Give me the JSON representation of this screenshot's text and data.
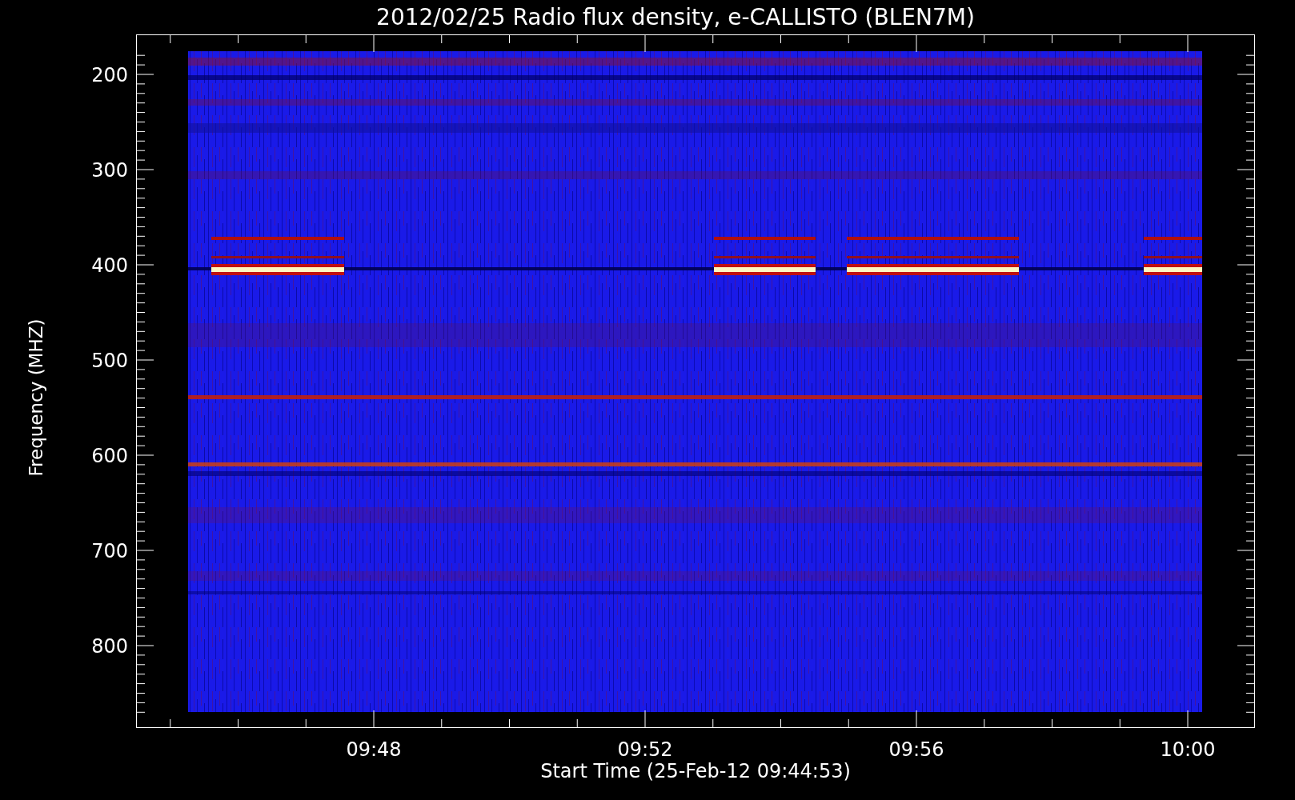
{
  "title": "2012/02/25  Radio flux density, e-CALLISTO (BLEN7M)",
  "y_axis": {
    "label": "Frequency (MHZ)",
    "ticks": [
      "200",
      "300",
      "400",
      "500",
      "600",
      "700",
      "800"
    ]
  },
  "x_axis": {
    "label": "Start Time (25-Feb-12 09:44:53)",
    "ticks": [
      "09:48",
      "09:52",
      "09:56",
      "10:00"
    ]
  }
}
